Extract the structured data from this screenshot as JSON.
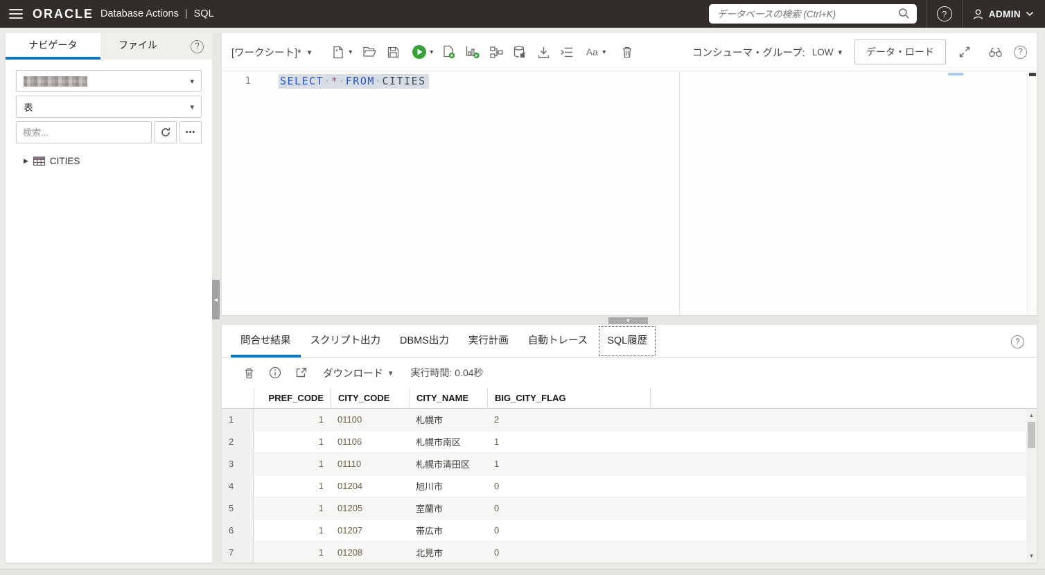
{
  "header": {
    "logo": "ORACLE",
    "product": "Database Actions",
    "divider": "|",
    "module": "SQL",
    "search_placeholder": "データベースの検索 (Ctrl+K)",
    "user_name": "ADMIN"
  },
  "sidebar": {
    "tab_navigator": "ナビゲータ",
    "tab_files": "ファイル",
    "object_type_value": "表",
    "search_placeholder": "検索...",
    "tree_item": "CITIES"
  },
  "worksheet": {
    "title": "[ワークシート]*",
    "consumer_group_label": "コンシューマ・グループ:",
    "consumer_group_value": "LOW",
    "data_load_button": "データ・ロード"
  },
  "editor": {
    "line_number": "1",
    "kw_select": "SELECT",
    "star": "*",
    "kw_from": "FROM",
    "table_name": "CITIES",
    "whitespace_dot": "·"
  },
  "results": {
    "tabs": [
      "問合せ結果",
      "スクリプト出力",
      "DBMS出力",
      "実行計画",
      "自動トレース",
      "SQL履歴"
    ],
    "download_label": "ダウンロード",
    "execution_time": "実行時間: 0.04秒",
    "grid": {
      "columns": [
        "PREF_CODE",
        "CITY_CODE",
        "CITY_NAME",
        "BIG_CITY_FLAG"
      ],
      "rows": [
        [
          "1",
          "1",
          "01100",
          "札幌市",
          "2"
        ],
        [
          "2",
          "1",
          "01106",
          "札幌市南区",
          "1"
        ],
        [
          "3",
          "1",
          "01110",
          "札幌市清田区",
          "1"
        ],
        [
          "4",
          "1",
          "01204",
          "旭川市",
          "0"
        ],
        [
          "5",
          "1",
          "01205",
          "室蘭市",
          "0"
        ],
        [
          "6",
          "1",
          "01207",
          "帯広市",
          "0"
        ],
        [
          "7",
          "1",
          "01208",
          "北見市",
          "0"
        ]
      ]
    }
  },
  "icons": {
    "caret_down": "▾",
    "tree_expand": "▶",
    "more": "•••",
    "split_down": "▼",
    "split_left": "◀",
    "question": "?",
    "aa": "Aa",
    "arrow_up_small": "▲",
    "arrow_down_small": "▼"
  },
  "colors": {
    "topbar": "#312d2a",
    "accent_blue": "#1074bb",
    "run_green": "#37a23c",
    "selection": "#d7dde3",
    "keyword_blue": "#2a55c8"
  }
}
